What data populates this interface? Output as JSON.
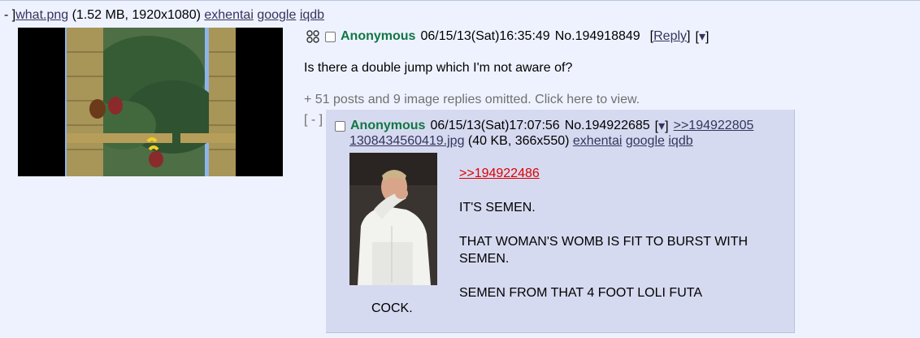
{
  "op": {
    "file": {
      "prefix": "- ]",
      "name": "what.png",
      "meta": " (1.52 MB, 1920x1080) ",
      "links": [
        "exhentai",
        "google",
        "iqdb"
      ]
    },
    "name": "Anonymous",
    "datetime": "06/15/13(Sat)16:35:49",
    "number": "No.194918849",
    "reply_label": "Reply",
    "menu_glyph": "▾",
    "message": "Is there a double jump which I'm not aware of?",
    "omitted": "+ 51 posts and 9 image replies omitted. Click here to view."
  },
  "reply": {
    "collapse": "[ - ]",
    "name": "Anonymous",
    "datetime": "06/15/13(Sat)17:07:56",
    "number": "No.194922685",
    "menu_glyph": "▾",
    "backlink": ">>194922805",
    "file": {
      "name": "1308434560419.jpg",
      "meta": " (40 KB, 366x550) ",
      "links": [
        "exhentai",
        "google",
        "iqdb"
      ]
    },
    "quotelink": ">>194922486",
    "lines": [
      "IT'S SEMEN.",
      "THAT WOMAN'S WOMB IS FIT TO BURST WITH SEMEN.",
      "SEMEN FROM THAT 4 FOOT LOLI FUTA"
    ],
    "tail": "COCK."
  },
  "colors": {
    "background": "#eef2ff",
    "reply_background": "#d6daf0",
    "name": "#117743",
    "link": "#34345c",
    "quote": "#dd0000"
  }
}
